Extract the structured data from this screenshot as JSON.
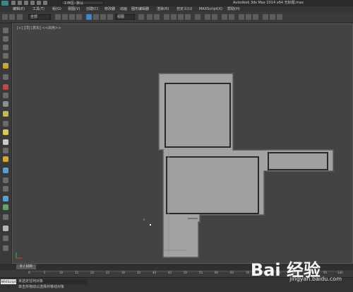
{
  "titlebar": {
    "workspace": "工作区: 默认",
    "app_title": "Autodesk 3ds Max  2014 x64    无标题.max"
  },
  "menubar": {
    "items": [
      "编辑(E)",
      "工具(T)",
      "组(G)",
      "视图(V)",
      "创建(C)",
      "修改器",
      "动画",
      "图形编辑器",
      "渲染(R)",
      "自定义(U)",
      "MAXScript(X)",
      "帮助(H)"
    ]
  },
  "toolbar": {
    "selection_filter": "全部",
    "coordinate_system": "视图"
  },
  "viewport": {
    "label": "[+] [顶] [真实] ",
    "label2": "<<启用>>"
  },
  "timeline": {
    "frame": "0 / 100"
  },
  "ruler": {
    "ticks": [
      "0",
      "5",
      "10",
      "15",
      "20",
      "25",
      "30",
      "35",
      "40",
      "45",
      "50",
      "55",
      "60",
      "65",
      "70",
      "75",
      "80",
      "85",
      "90",
      "95",
      "100"
    ]
  },
  "status": {
    "maxscript_tab": "MAXScript 迷",
    "line1": "未选定任何对象",
    "line2": "单击并拖动以选择并移动对象"
  },
  "watermark": {
    "brand": "Bai 经验",
    "url": "jingyan.baidu.com"
  },
  "colors": {
    "viewport_bg": "#434343",
    "model_fill": "#a0a0a0",
    "model_dark": "#6f6f6f",
    "accent_blue": "#3f86c6"
  }
}
